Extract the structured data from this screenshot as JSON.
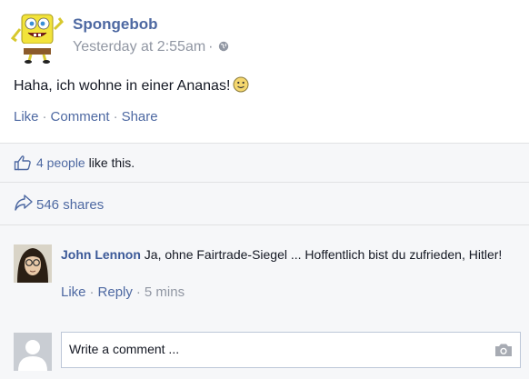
{
  "post": {
    "author": "Spongebob",
    "timestamp": "Yesterday at 2:55am",
    "separator": "·",
    "privacy_icon": "globe-icon",
    "text": "Haha, ich wohne in einer Ananas!",
    "emoticon": "smiley-icon",
    "actions": {
      "like": "Like",
      "comment": "Comment",
      "share": "Share",
      "separator": "·"
    }
  },
  "likes": {
    "icon": "thumbs-up-icon",
    "count_link": "4 people",
    "suffix": " like this."
  },
  "shares": {
    "icon": "share-arrow-icon",
    "label": "546 shares"
  },
  "comments": [
    {
      "author": "John Lennon",
      "text": "Ja, ohne Fairtrade-Siegel ... Hoffentlich bist du zufrieden, Hitler!",
      "actions": {
        "like": "Like",
        "reply": "Reply",
        "time": "5 mins",
        "separator": "·"
      }
    }
  ],
  "comment_box": {
    "placeholder": "Write a comment ...",
    "camera_icon": "camera-icon"
  },
  "colors": {
    "link": "#3b5998",
    "action_link": "#4e69a2",
    "muted": "#9197a3",
    "panel_bg": "#f6f7f9",
    "border": "#e1e2e3"
  }
}
